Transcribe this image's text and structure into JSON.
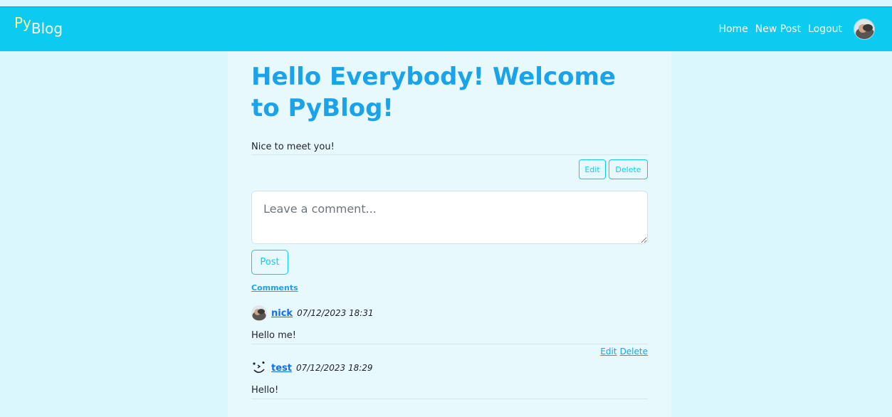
{
  "nav": {
    "brand_py": "Py",
    "brand_blog": "Blog",
    "links": [
      "Home",
      "New Post",
      "Logout"
    ]
  },
  "post": {
    "title": "Hello Everybody! Welcome to PyBlog!",
    "body": "Nice to meet you!",
    "edit_label": "Edit",
    "delete_label": "Delete"
  },
  "comment_form": {
    "placeholder": "Leave a comment...",
    "post_label": "Post"
  },
  "comments": {
    "heading": "Comments",
    "items": [
      {
        "author": "nick",
        "date": "07/12/2023 18:31",
        "text": "Hello me!",
        "edit_label": "Edit",
        "delete_label": "Delete"
      },
      {
        "author": "test",
        "date": "07/12/2023 18:29",
        "text": "Hello!"
      }
    ]
  },
  "colors": {
    "navbar": "#0dcaf0",
    "accent": "#1aa3e8",
    "page_bg": "#d9f7fc",
    "content_bg": "#e8f9fe"
  },
  "icons": {
    "nav_avatar": "user-avatar-icon",
    "nick_avatar": "user-avatar-icon",
    "test_avatar": "smiley-face-avatar-icon"
  }
}
